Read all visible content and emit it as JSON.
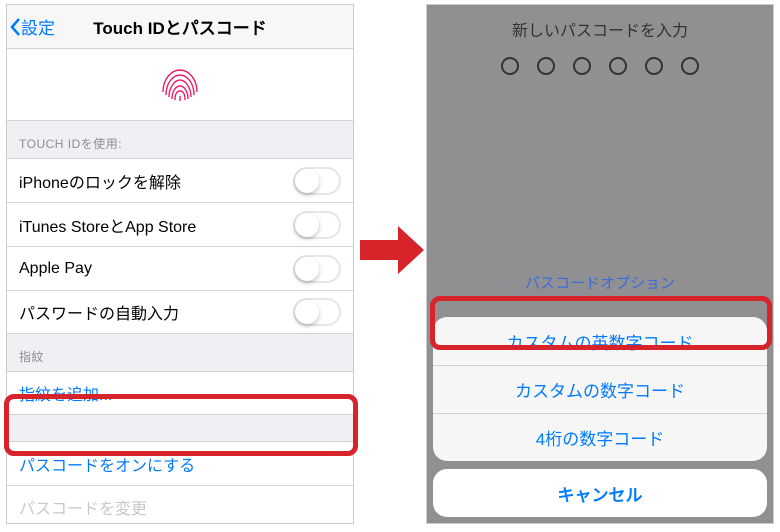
{
  "left": {
    "nav_back": "設定",
    "nav_title": "Touch IDとパスコード",
    "section_use": "TOUCH IDを使用:",
    "toggle_items": [
      "iPhoneのロックを解除",
      "iTunes StoreとApp Store",
      "Apple Pay",
      "パスワードの自動入力"
    ],
    "section_fp": "指紋",
    "add_fingerprint": "指紋を追加...",
    "passcode_on": "パスコードをオンにする",
    "passcode_change": "パスコードを変更"
  },
  "right": {
    "enter_title": "新しいパスコードを入力",
    "options_link": "パスコードオプション",
    "sheet": [
      "カスタムの英数字コード",
      "カスタムの数字コード",
      "4桁の数字コード"
    ],
    "cancel": "キャンセル"
  }
}
